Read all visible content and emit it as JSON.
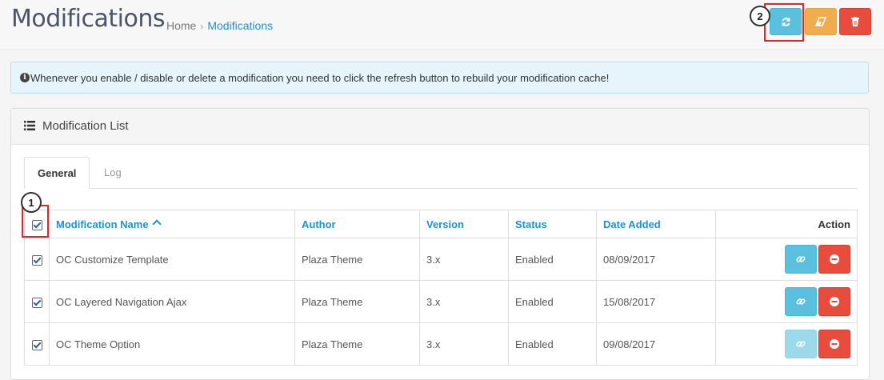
{
  "header": {
    "title": "Modifications",
    "breadcrumb": [
      {
        "label": "Home"
      },
      {
        "label": "Modifications"
      }
    ],
    "breadcrumb_separator": "›"
  },
  "toolbar": {
    "refresh_icon": "refresh-icon",
    "clear_icon": "eraser-icon",
    "delete_icon": "trash-icon"
  },
  "callouts": {
    "one": "1",
    "two": "2"
  },
  "alert": {
    "icon": "info-circle-icon",
    "text": "Whenever you enable / disable or delete a modification you need to click the refresh button to rebuild your modification cache!"
  },
  "panel": {
    "title": "Modification List",
    "icon": "list-icon",
    "tabs": [
      {
        "label": "General"
      },
      {
        "label": "Log"
      }
    ]
  },
  "table": {
    "headers": {
      "name": "Modification Name",
      "author": "Author",
      "version": "Version",
      "status": "Status",
      "date_added": "Date Added",
      "action": "Action"
    },
    "rows": [
      {
        "name": "OC Customize Template",
        "author": "Plaza Theme",
        "version": "3.x",
        "status": "Enabled",
        "date_added": "08/09/2017"
      },
      {
        "name": "OC Layered Navigation Ajax",
        "author": "Plaza Theme",
        "version": "3.x",
        "status": "Enabled",
        "date_added": "15/08/2017"
      },
      {
        "name": "OC Theme Option",
        "author": "Plaza Theme",
        "version": "3.x",
        "status": "Enabled",
        "date_added": "09/08/2017"
      }
    ]
  },
  "colors": {
    "info": "#5bc0de",
    "warning": "#f0ad4e",
    "danger": "#e74c3c",
    "link": "#1e91cf",
    "highlight": "#e0262f"
  }
}
